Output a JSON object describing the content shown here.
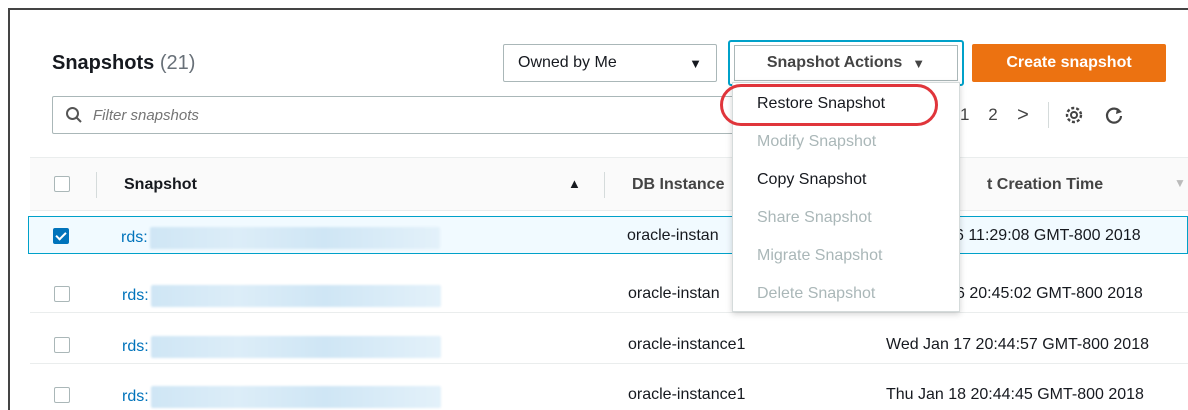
{
  "header": {
    "title": "Snapshots",
    "count": "(21)"
  },
  "filter_owner": {
    "selected": "Owned by Me"
  },
  "actions_button": {
    "label": "Snapshot Actions"
  },
  "create_button": {
    "label": "Create snapshot"
  },
  "search": {
    "placeholder": "Filter snapshots"
  },
  "pagination": {
    "page_current_partial": "1",
    "page_next": "2",
    "next": ">"
  },
  "columns": {
    "snapshot": "Snapshot",
    "db_instance": "DB Instance",
    "creation_time": "t Creation Time"
  },
  "actions_menu": [
    {
      "label": "Restore Snapshot",
      "enabled": true
    },
    {
      "label": "Modify Snapshot",
      "enabled": false
    },
    {
      "label": "Copy Snapshot",
      "enabled": true
    },
    {
      "label": "Share Snapshot",
      "enabled": false
    },
    {
      "label": "Migrate Snapshot",
      "enabled": false
    },
    {
      "label": "Delete Snapshot",
      "enabled": false
    }
  ],
  "rows": [
    {
      "checked": true,
      "snapshot": "rds:",
      "db_instance": "oracle-instan",
      "creation_time": "6 11:29:08 GMT-800 2018"
    },
    {
      "checked": false,
      "snapshot": "rds:",
      "db_instance": "oracle-instan",
      "creation_time": "6 20:45:02 GMT-800 2018"
    },
    {
      "checked": false,
      "snapshot": "rds:",
      "db_instance": "oracle-instance1",
      "creation_time": "Wed Jan 17 20:44:57 GMT-800 2018"
    },
    {
      "checked": false,
      "snapshot": "rds:",
      "db_instance": "oracle-instance1",
      "creation_time": "Thu Jan 18 20:44:45 GMT-800 2018"
    }
  ],
  "colors": {
    "accent": "#00a1c9",
    "primary_button": "#ec7211",
    "link": "#0073bb",
    "highlight_circle": "#e0353b"
  }
}
